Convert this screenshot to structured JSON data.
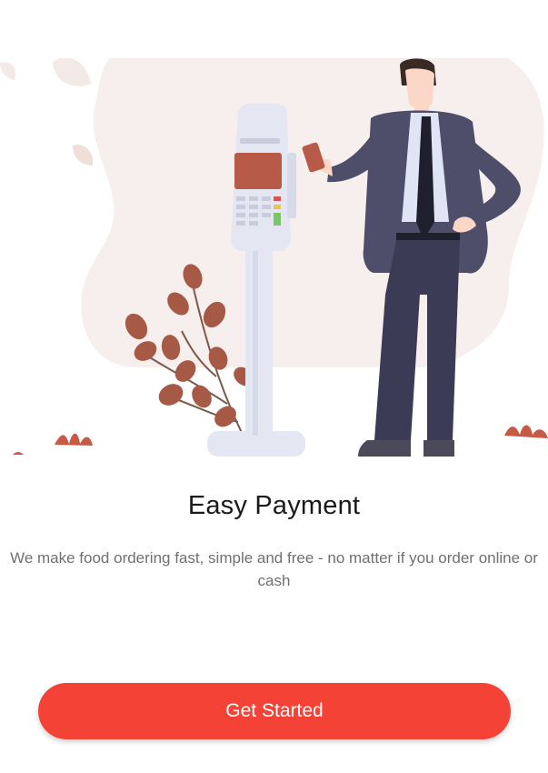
{
  "onboarding": {
    "title": "Easy Payment",
    "description": "We make food ordering fast, simple and free - no matter if you order online or cash",
    "cta_label": "Get Started"
  },
  "colors": {
    "accent": "#f44336",
    "blob": "#f6efee",
    "leaf": "#a85a46",
    "suit": "#4e4e6a",
    "terminal": "#e4e6f1",
    "screen": "#b85a48"
  },
  "illustration": {
    "icon": "card-payment-terminal-illustration"
  }
}
